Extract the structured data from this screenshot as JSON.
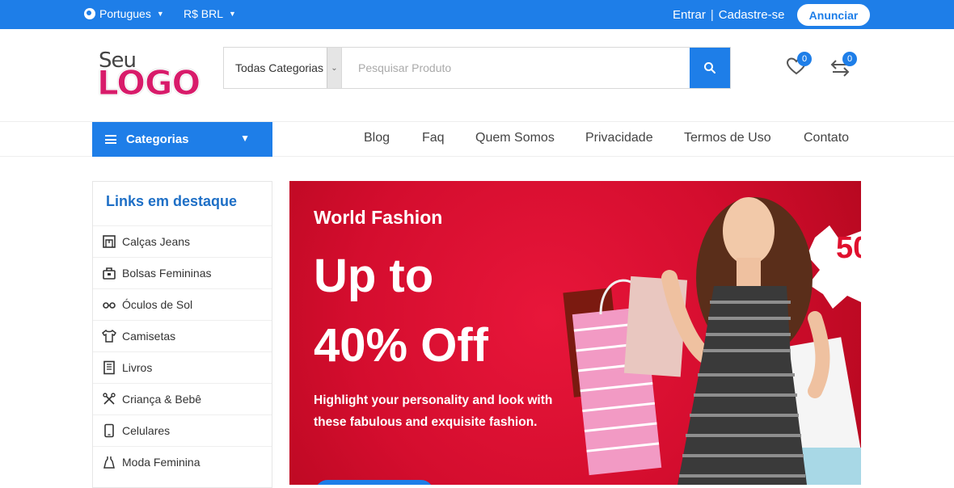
{
  "topbar": {
    "language": "Portugues",
    "currency": "R$ BRL",
    "login": "Entrar",
    "separator": "|",
    "register": "Cadastre-se",
    "announce": "Anunciar"
  },
  "logo": {
    "line1": "Seu",
    "line2": "LOGO"
  },
  "search": {
    "category": "Todas Categorias",
    "placeholder": "Pesquisar Produto"
  },
  "header_icons": {
    "wishlist_count": "0",
    "compare_count": "0"
  },
  "nav": {
    "categories_label": "Categorias",
    "links": [
      "Blog",
      "Faq",
      "Quem Somos",
      "Privacidade",
      "Termos de Uso",
      "Contato"
    ]
  },
  "sidebar": {
    "title": "Links em destaque",
    "items": [
      {
        "label": "Calças Jeans",
        "icon": "jeans-icon"
      },
      {
        "label": "Bolsas Femininas",
        "icon": "bag-icon"
      },
      {
        "label": "Óculos de Sol",
        "icon": "sunglasses-icon"
      },
      {
        "label": "Camisetas",
        "icon": "tshirt-icon"
      },
      {
        "label": "Livros",
        "icon": "book-icon"
      },
      {
        "label": "Criança & Bebê",
        "icon": "baby-icon"
      },
      {
        "label": "Celulares",
        "icon": "phone-icon"
      },
      {
        "label": "Moda Feminina",
        "icon": "dress-icon"
      }
    ]
  },
  "banner": {
    "subtitle": "World Fashion",
    "headline_1": "Up to",
    "headline_2": "40% Off",
    "description": "Highlight your personality and look with these fabulous and exquisite fashion.",
    "sale_tag": "50"
  },
  "colors": {
    "primary": "#1e7ee8",
    "banner_red": "#d40d2e",
    "logo_pink": "#d81b6a"
  }
}
